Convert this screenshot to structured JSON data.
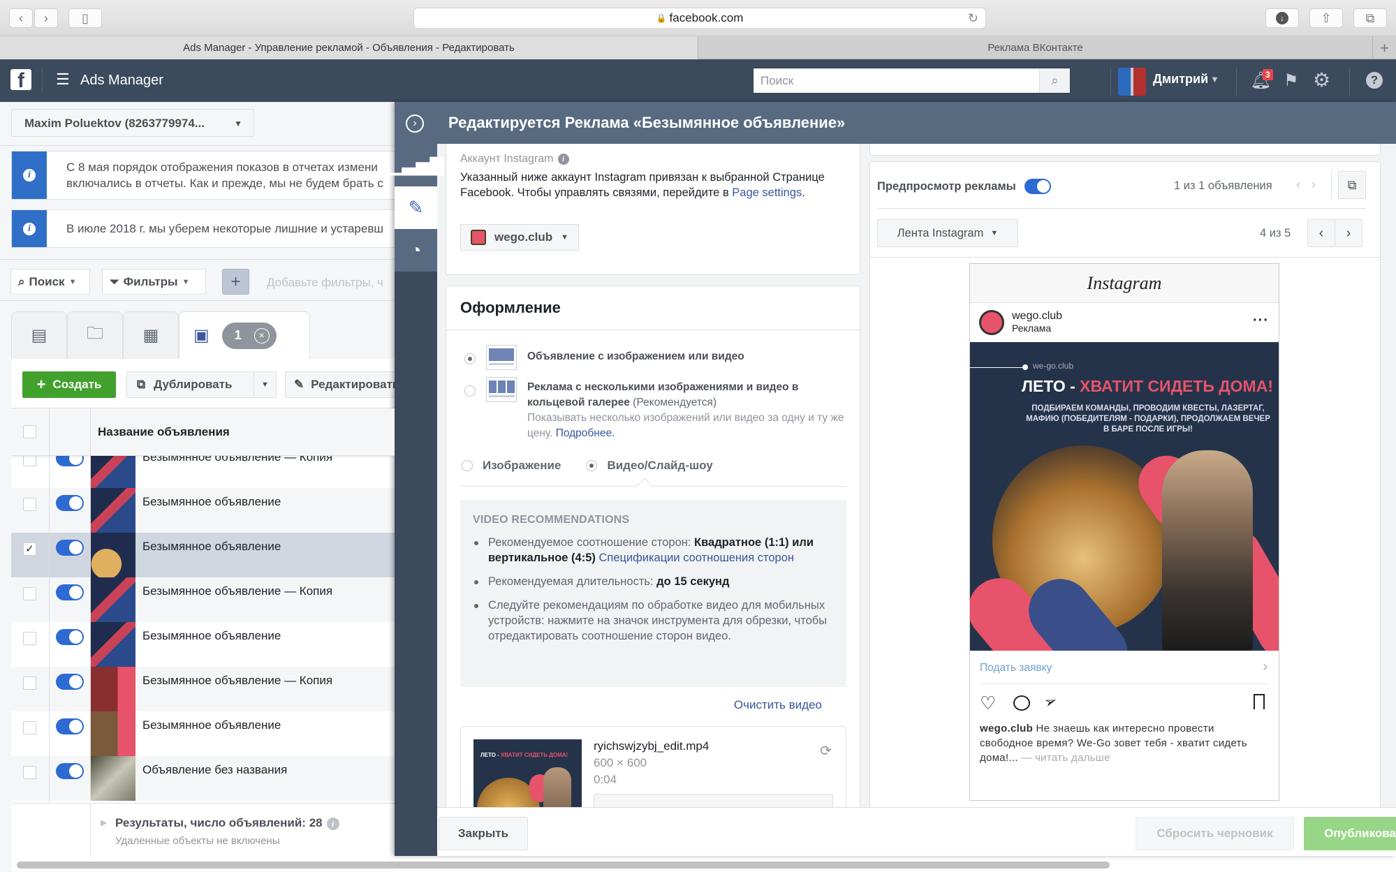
{
  "browser": {
    "url": "facebook.com",
    "tabs": [
      {
        "label": "Ads Manager - Управление рекламой - Объявления - Редактировать",
        "active": true
      },
      {
        "label": "Реклама ВКонтакте",
        "active": false
      }
    ],
    "new_tab": "+"
  },
  "topbar": {
    "app_title": "Ads Manager",
    "search_placeholder": "Поиск",
    "user_name": "Дмитрий",
    "notification_count": "3"
  },
  "left": {
    "account": "Maxim Poluektov (8263779974...",
    "notices": [
      {
        "line1": "С 8 мая порядок отображения показов в отчетах измени",
        "line2": "включались в отчеты. Как и прежде, мы не будем брать с"
      },
      {
        "line1": "В июле 2018 г. мы уберем некоторые лишние и устаревш"
      }
    ],
    "search_btn": "Поиск",
    "filters_btn": "Фильтры",
    "filter_hint": "Добавьте фильтры, ч",
    "selected_count": "1",
    "actions": {
      "create": "Создать",
      "duplicate": "Дублировать",
      "edit": "Редактировать"
    },
    "table": {
      "header": "Название объявления",
      "rows": [
        {
          "name": "Безымянное объявление — Копия",
          "checked": false,
          "on": true
        },
        {
          "name": "Безымянное объявление",
          "checked": false,
          "on": true
        },
        {
          "name": "Безымянное объявление",
          "checked": true,
          "on": true
        },
        {
          "name": "Безымянное объявление — Копия",
          "checked": false,
          "on": true
        },
        {
          "name": "Безымянное объявление",
          "checked": false,
          "on": true
        },
        {
          "name": "Безымянное объявление — Копия",
          "checked": false,
          "on": true
        },
        {
          "name": "Безымянное объявление",
          "checked": false,
          "on": true
        },
        {
          "name": "Объявление без названия",
          "checked": false,
          "on": true
        }
      ]
    },
    "footer": {
      "results": "Результаты, число объявлений: 28",
      "sub": "Удаленные объекты не включены"
    }
  },
  "editor": {
    "title": "Редактируется Реклама «Безымянное объявление»",
    "instagram": {
      "label": "Аккаунт Instagram",
      "desc_before": "Указанный ниже аккаунт Instagram привязан к выбранной Странице Facebook. Чтобы управлять связями, перейдите в ",
      "desc_link": "Page settings",
      "desc_after": ".",
      "account": "wego.club"
    },
    "format": {
      "title": "Оформление",
      "option1": "Объявление с изображением или видео",
      "option2_bold": "Реклама с несколькими изображениями и видео в кольцевой галерее",
      "option2_rec": "(Рекомендуется)",
      "option2_desc": "Показывать несколько изображений или видео за одну и ту же цену.",
      "option2_link": "Подробнее.",
      "media_image": "Изображение",
      "media_video": "Видео/Слайд-шоу"
    },
    "recommendations": {
      "title": "VIDEO RECOMMENDATIONS",
      "r1_label": "Рекомендуемое соотношение сторон: ",
      "r1_value": "Квадратное (1:1) или вертикальное (4:5)",
      "r1_link": "Спецификации соотношения сторон",
      "r2_label": "Рекомендуемая длительность: ",
      "r2_value": "до 15 секунд",
      "r3": "Следуйте рекомендациям по обработке видео для мобильных устройств: нажмите на значок инструмента для обрезки, чтобы отредактировать соотношение сторон видео."
    },
    "clear_video": "Очистить видео",
    "video": {
      "filename": "ryichswjzybj_edit.mp4",
      "dimensions": "600 × 600",
      "duration": "0:04"
    },
    "buttons": {
      "close": "Закрыть",
      "reset": "Сбросить черновик",
      "publish": "Опубликовать"
    }
  },
  "preview": {
    "label": "Предпросмотр рекламы",
    "enabled": true,
    "ad_counter": "1 из 1 объявления",
    "placement": "Лента Instagram",
    "placement_counter": "4 из 5",
    "ig": {
      "logo": "Instagram",
      "account": "wego.club",
      "sponsored": "Реклама",
      "creative_site": "we-go.club",
      "creative_title_white": "ЛЕТО - ",
      "creative_title_red": "ХВАТИТ СИДЕТЬ ДОМА!",
      "creative_sub": "ПОДБИРАЕМ КОМАНДЫ, ПРОВОДИМ КВЕСТЫ, ЛАЗЕРТАГ, МАФИЮ (ПОБЕДИТЕЛЯМ - ПОДАРКИ), ПРОДОЛЖАЕМ ВЕЧЕР В БАРЕ ПОСЛЕ ИГРЫ!",
      "cta": "Подать заявку",
      "caption_user": "wego.club",
      "caption": " Не знаешь как интересно провести свободное время? We-Go зовет тебя - хватит сидеть дома!...",
      "read_more": " — читать дальше"
    }
  },
  "colors": {
    "accent": "#2d6ad3",
    "header": "#3b4a5c",
    "editor_header": "#576a80",
    "create_green": "#42a12c",
    "publish_green": "#97d686",
    "brand_red": "#e6536a"
  }
}
